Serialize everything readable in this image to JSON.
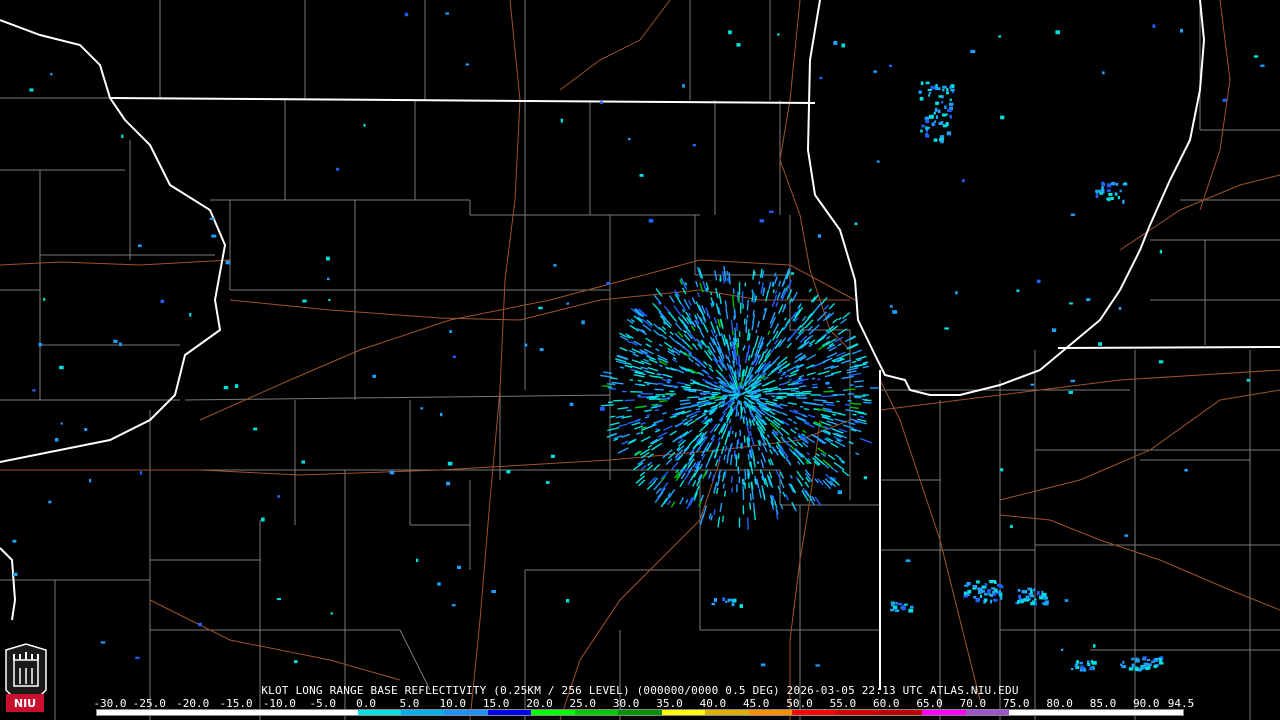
{
  "caption": "KLOT LONG RANGE BASE REFLECTIVITY (0.25KM / 256 LEVEL) (000000/0000 0.5 DEG) 2026-03-05 22:13 UTC  ATLAS.NIU.EDU",
  "logo_text": "NIU",
  "scale": {
    "labels": [
      "-30.0",
      "-25.0",
      "-20.0",
      "-15.0",
      "-10.0",
      "-5.0",
      "0.0",
      "5.0",
      "10.0",
      "15.0",
      "20.0",
      "25.0",
      "30.0",
      "35.0",
      "40.0",
      "45.0",
      "50.0",
      "55.0",
      "60.0",
      "65.0",
      "70.0",
      "75.0",
      "80.0",
      "85.0",
      "90.0",
      "94.5"
    ],
    "colors": [
      "#ffffff",
      "#ffffff",
      "#ffffff",
      "#ffffff",
      "#ffffff",
      "#ffffff",
      "#00e0e0",
      "#00b0f0",
      "#2090ff",
      "#0000f0",
      "#00ff00",
      "#00c800",
      "#009000",
      "#ffff00",
      "#e0b000",
      "#ff9000",
      "#ff0000",
      "#d00000",
      "#c00000",
      "#ff00ff",
      "#9955c9",
      "#ffffff",
      "#ffffff",
      "#ffffff",
      "#ffffff"
    ]
  },
  "colors": {
    "background": "#000000",
    "state_border": "#ffffff",
    "county_line": "#7a7a7a",
    "highway": "#a0522d",
    "echo_light": "#00e0e0",
    "echo_mid": "#20a0ff",
    "echo_dark": "#2060ff",
    "echo_green": "#00c000"
  }
}
